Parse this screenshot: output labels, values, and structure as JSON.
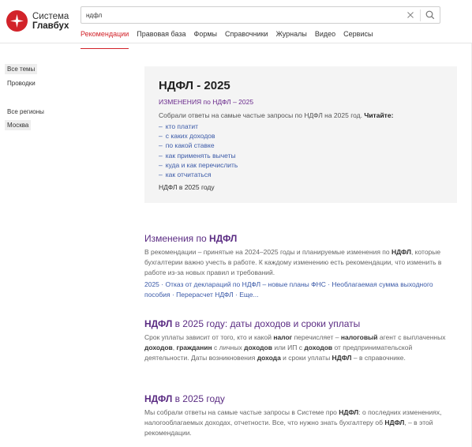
{
  "brand": {
    "line1": "Система",
    "line2": "Главбух",
    "color": "#d2232a"
  },
  "search": {
    "value": "ндфл",
    "clear_icon": "close-icon",
    "search_icon": "search-icon"
  },
  "nav": {
    "tabs": [
      {
        "label": "Рекомендации",
        "active": true
      },
      {
        "label": "Правовая база"
      },
      {
        "label": "Формы"
      },
      {
        "label": "Справочники"
      },
      {
        "label": "Журналы"
      },
      {
        "label": "Видео"
      },
      {
        "label": "Сервисы"
      }
    ]
  },
  "sidebar": {
    "topics": [
      {
        "label": "Все темы",
        "selected": true
      },
      {
        "label": "Проводки"
      }
    ],
    "regions": [
      {
        "label": "Все регионы"
      },
      {
        "label": "Москва",
        "selected": true
      }
    ]
  },
  "card": {
    "title": "НДФЛ - 2025",
    "link": "ИЗМЕНЕНИЯ по НДФЛ – 2025",
    "intro": "Собрали ответы на самые частые запросы по НДФЛ на 2025 год.",
    "intro_bold": "Читайте:",
    "items": [
      "кто платит",
      "с каких доходов",
      "по какой ставке",
      "как применять вычеты",
      "куда и как перечислить",
      "как отчитаться"
    ],
    "footer": "НДФЛ в 2025 году"
  },
  "results": [
    {
      "title_pre": "Изменения по ",
      "title_bold": "НДФЛ",
      "title_post": "",
      "text": [
        {
          "t": "В рекомендации – принятые на 2024–2025 годы и планируемые изменения по "
        },
        {
          "t": "НДФЛ",
          "b": true
        },
        {
          "t": ", которые бухгалтерии важно учесть в работе. К каждому изменению есть рекомендации, что изменить в работе из-за новых правил и требований."
        }
      ],
      "tags": "2025 · Отказ от деклараций по НДФЛ – новые планы ФНС · Необлагаемая сумма выходного пособия · Перерасчет НДФЛ · Еще..."
    },
    {
      "title_pre": "",
      "title_bold": "НДФЛ",
      "title_post": " в 2025 году: даты доходов и сроки уплаты",
      "text": [
        {
          "t": "Срок уплаты зависит от того, кто и какой "
        },
        {
          "t": "налог",
          "b": true
        },
        {
          "t": " перечисляет – "
        },
        {
          "t": "налоговый",
          "b": true
        },
        {
          "t": " агент с выплаченных "
        },
        {
          "t": "доходов",
          "b": true
        },
        {
          "t": ", "
        },
        {
          "t": "гражданин",
          "b": true
        },
        {
          "t": " с личных "
        },
        {
          "t": "доходов",
          "b": true
        },
        {
          "t": " или ИП с "
        },
        {
          "t": "доходов",
          "b": true
        },
        {
          "t": " от предпринимательской деятельности. Даты возникновения "
        },
        {
          "t": "дохода",
          "b": true
        },
        {
          "t": " и сроки уплаты "
        },
        {
          "t": "НДФЛ",
          "b": true
        },
        {
          "t": " – в справочнике."
        }
      ],
      "tags": ""
    },
    {
      "title_pre": "",
      "title_bold": "НДФЛ",
      "title_post": " в 2025 году",
      "text": [
        {
          "t": "Мы собрали ответы на самые частые запросы в Системе про "
        },
        {
          "t": "НДФЛ",
          "b": true
        },
        {
          "t": ": о последних изменениях, налогооблагаемых доходах, отчетности. Все, что нужно знать бухгалтеру об "
        },
        {
          "t": "НДФЛ",
          "b": true
        },
        {
          "t": ", – в этой рекомендации."
        }
      ],
      "tags": ""
    }
  ]
}
